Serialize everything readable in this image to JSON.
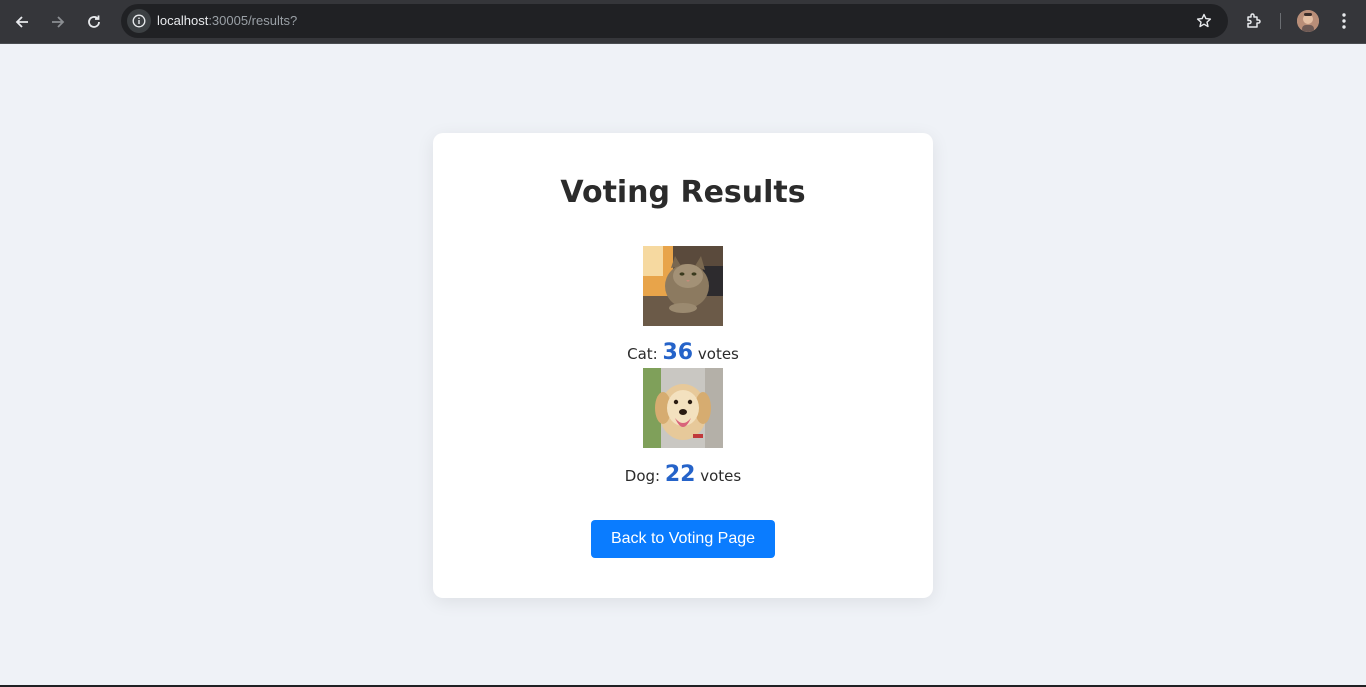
{
  "browser": {
    "url_host": "localhost",
    "url_rest": ":30005/results?"
  },
  "page": {
    "title": "Voting Results",
    "results": [
      {
        "label": "Cat: ",
        "count": "36",
        "suffix": " votes"
      },
      {
        "label": "Dog: ",
        "count": "22",
        "suffix": " votes"
      }
    ],
    "back_button_label": "Back to Voting Page"
  },
  "colors": {
    "accent": "#0a7cff",
    "count": "#2563c9",
    "background": "#eff2f7"
  }
}
